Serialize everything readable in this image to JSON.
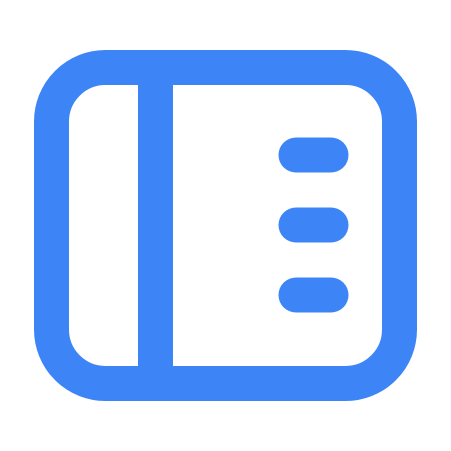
{
  "icon": {
    "name": "sidebar-panel-icon",
    "stroke_color": "#3D85F7",
    "background_color": "#FFFFFF"
  }
}
